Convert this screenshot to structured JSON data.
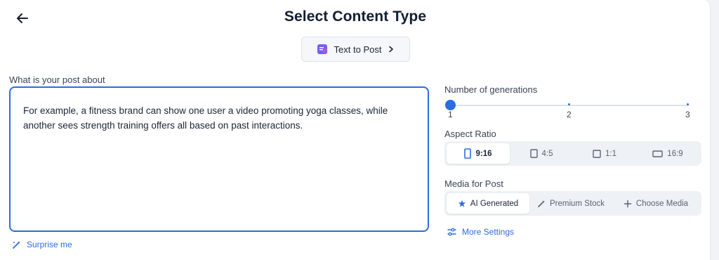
{
  "header": {
    "title": "Select Content Type",
    "back_icon": "arrow-left-icon"
  },
  "content_type": {
    "label": "Text to Post",
    "icon": "text-post-icon",
    "chevron_icon": "chevron-right-icon"
  },
  "post": {
    "label": "What is your post about",
    "text": "For example, a fitness brand can show one user a video promoting yoga classes, while another sees strength training offers all based on past interactions."
  },
  "surprise": {
    "label": "Surprise me",
    "icon": "magic-wand-icon"
  },
  "generations": {
    "label": "Number of generations",
    "ticks": [
      "1",
      "2",
      "3"
    ],
    "value": 1,
    "min": 1,
    "max": 3
  },
  "aspect_ratio": {
    "label": "Aspect Ratio",
    "options": [
      "9:16",
      "4:5",
      "1:1",
      "16:9"
    ],
    "selected": "9:16"
  },
  "media": {
    "label": "Media for Post",
    "options": [
      "AI Generated",
      "Premium Stock",
      "Choose Media"
    ],
    "selected": "AI Generated"
  },
  "more_settings": {
    "label": "More Settings",
    "icon": "sliders-icon"
  },
  "colors": {
    "accent": "#2a6de0",
    "title": "#131e33",
    "background": "#ffffff"
  }
}
